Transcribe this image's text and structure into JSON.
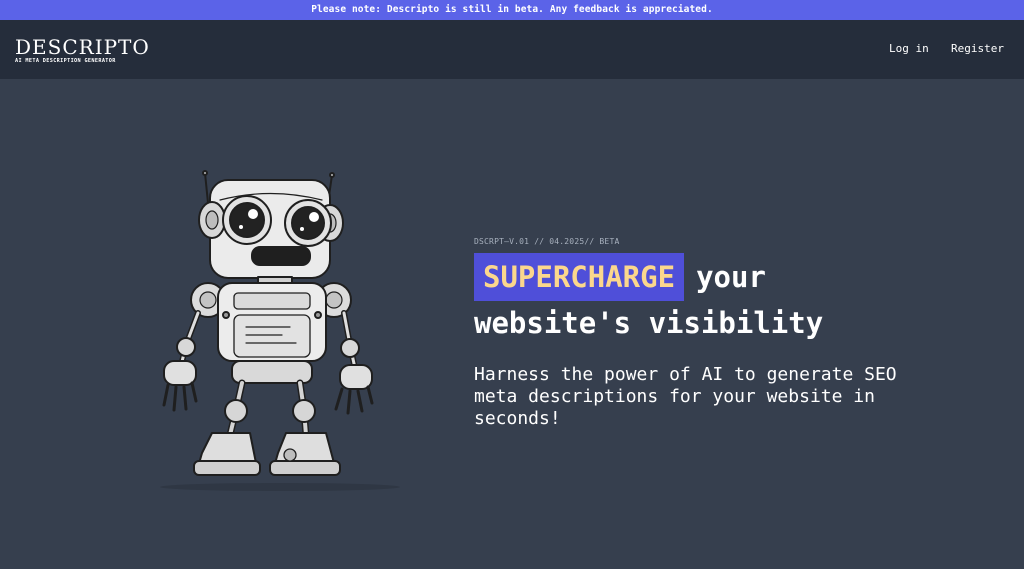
{
  "banner": {
    "text": "Please note: Descripto is still in beta. Any feedback is appreciated."
  },
  "header": {
    "logo_title": "DESCRIPTO",
    "logo_subtitle": "AI META DESCRIPTION GENERATOR",
    "nav": {
      "login": "Log in",
      "register": "Register"
    }
  },
  "hero": {
    "version": "DSCRPT—V.01 // 04.2025// BETA",
    "highlight": "SUPERCHARGE",
    "headline_part1": "your",
    "headline_part2": "website's visibility",
    "tagline": "Harness the power of AI to generate SEO meta descriptions for your website in seconds!"
  },
  "colors": {
    "banner_bg": "#5b63e8",
    "header_bg": "#252d3b",
    "page_bg": "#363f4e",
    "highlight_bg": "#4f4fd9",
    "highlight_text": "#fbd78d"
  },
  "illustration": {
    "icon": "robot-illustration"
  }
}
